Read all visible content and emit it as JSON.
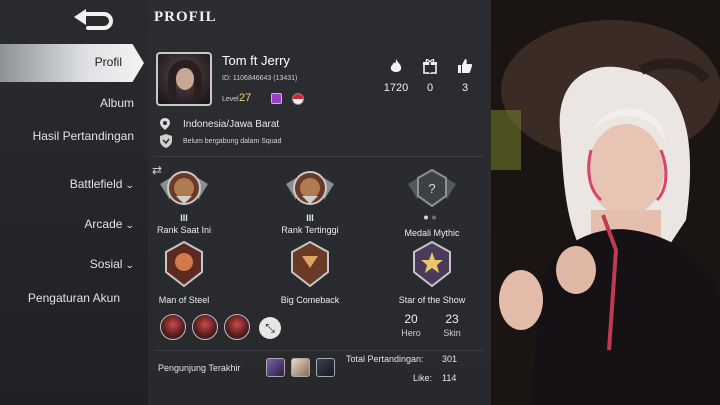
{
  "header": {
    "title": "PROFIL"
  },
  "sidebar": {
    "items": [
      {
        "label": "Profil",
        "active": true,
        "expandable": false
      },
      {
        "label": "Album",
        "active": false,
        "expandable": false
      },
      {
        "label": "Hasil Pertandingan",
        "active": false,
        "expandable": false
      },
      {
        "label": "Battlefield",
        "active": false,
        "expandable": true
      },
      {
        "label": "Arcade",
        "active": false,
        "expandable": true
      },
      {
        "label": "Sosial",
        "active": false,
        "expandable": true
      },
      {
        "label": "Pengaturan Akun",
        "active": false,
        "expandable": false
      }
    ]
  },
  "profile": {
    "name": "Tom ft Jerry",
    "id_text": "ID: 1106846643 (13431)",
    "level_label": "Level",
    "level": "27",
    "location": "Indonesia/Jawa Barat",
    "squad_status": "Belum bergabung dalam Squad"
  },
  "stats": {
    "popularity": "1720",
    "gifts": "0",
    "likes": "3"
  },
  "ranks": {
    "current": {
      "label": "Rank Saat Ini",
      "tier": "III"
    },
    "highest": {
      "label": "Rank Tertinggi",
      "tier": "III"
    },
    "mythic": {
      "label": "Medali Mythic"
    }
  },
  "achievements": [
    {
      "label": "Man of Steel"
    },
    {
      "label": "Big Comeback"
    },
    {
      "label": "Star of the Show"
    }
  ],
  "collection": {
    "hero_count": "20",
    "hero_label": "Hero",
    "skin_count": "23",
    "skin_label": "Skin"
  },
  "footer": {
    "visitors_label": "Pengunjung Terakhir",
    "total_matches_label": "Total Pertandingan:",
    "total_matches": "301",
    "like_label": "Like:",
    "like_count": "114"
  },
  "colors": {
    "accent_gold": "#f3d36b",
    "panel_bg": "#2b2d31",
    "sidebar_active": "#dfe1e4"
  }
}
